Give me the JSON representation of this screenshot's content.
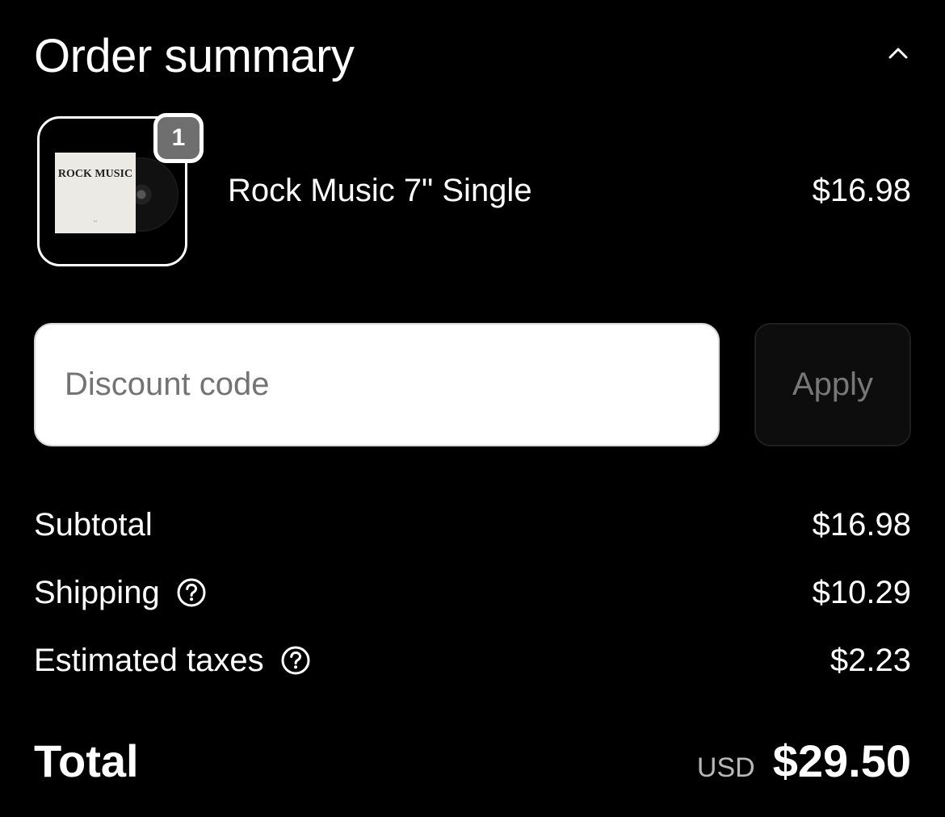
{
  "header": {
    "title": "Order summary",
    "toggle_icon": "chevron-up-icon"
  },
  "line_item": {
    "quantity": "1",
    "name": "Rock Music 7\" Single",
    "price": "$16.98",
    "thumbnail_text": "ROCK MUSIC"
  },
  "discount": {
    "placeholder": "Discount code",
    "value": "",
    "apply_label": "Apply"
  },
  "summary": {
    "subtotal_label": "Subtotal",
    "subtotal_value": "$16.98",
    "shipping_label": "Shipping",
    "shipping_value": "$10.29",
    "taxes_label": "Estimated taxes",
    "taxes_value": "$2.23",
    "help_icon": "question-circle-icon"
  },
  "total": {
    "label": "Total",
    "currency": "USD",
    "value": "$29.50"
  },
  "colors": {
    "background": "#000000",
    "text": "#ffffff",
    "muted_text": "#737373",
    "badge": "#6f6f6f",
    "input_background": "#ffffff",
    "button_background": "#0d0d0d"
  }
}
